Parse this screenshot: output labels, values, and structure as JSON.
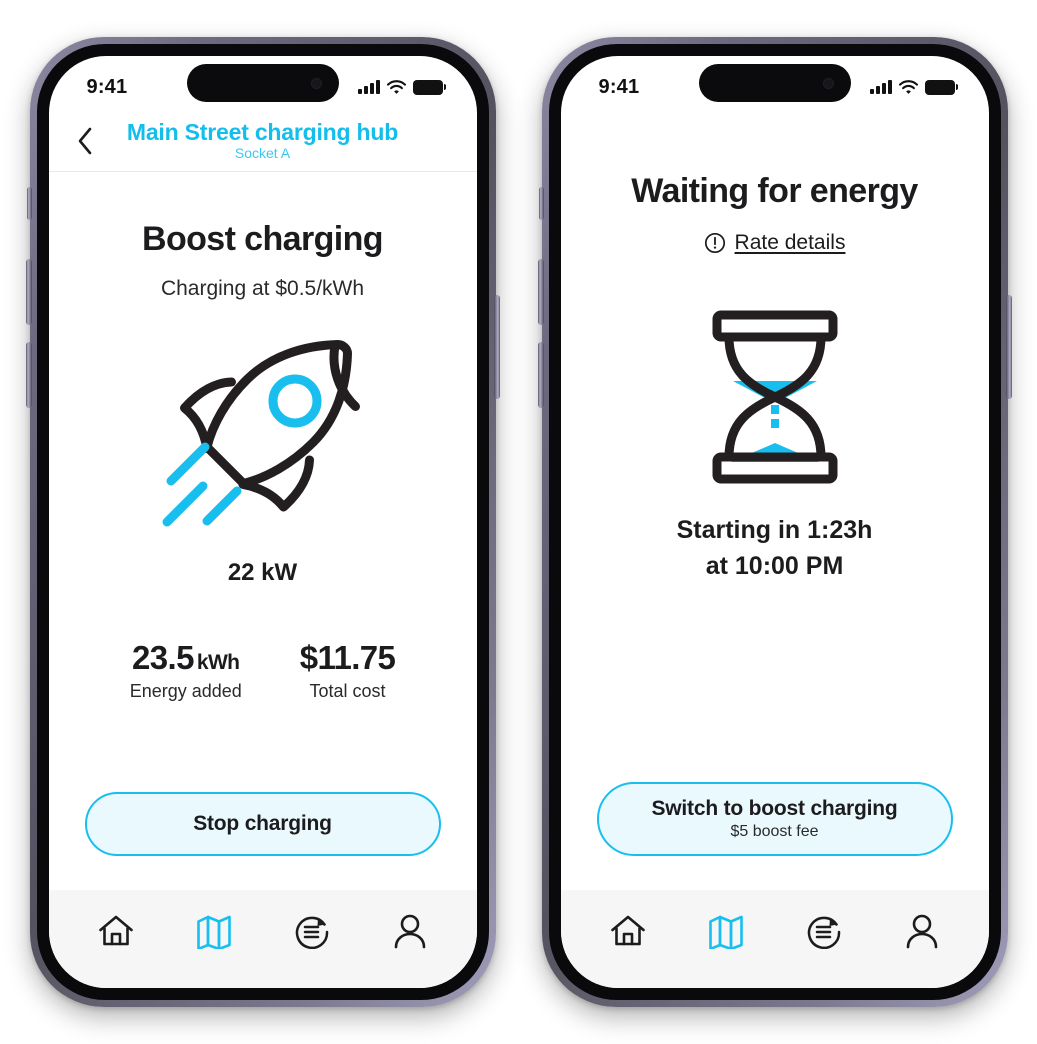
{
  "colors": {
    "accent": "#13BEEC",
    "accent_bright": "#18BFEE",
    "cta_fill": "#EAF9FE",
    "text_dark": "#1c1c1e",
    "tabbar_bg": "#F6F6F7",
    "frame_black": "#0a0a0c",
    "frame_titanium": "#6d6980"
  },
  "status_bar": {
    "time": "9:41",
    "icons": [
      "cellular-signal-icon",
      "wifi-icon",
      "battery-icon"
    ]
  },
  "phones": [
    {
      "id": "phone-boost-charging",
      "header": {
        "back_icon": "chevron-left-icon",
        "title": "Main Street charging hub",
        "subtitle": "Socket A"
      },
      "screen_title": "Boost charging",
      "screen_subtitle": "Charging at $0.5/kWh",
      "hero_icon": "rocket-icon",
      "power_readout": "22 kW",
      "stats": [
        {
          "value": "23.5",
          "unit": "kWh",
          "label": "Energy added"
        },
        {
          "value": "$11.75",
          "unit": "",
          "label": "Total cost"
        }
      ],
      "cta": {
        "label": "Stop charging",
        "sublabel": ""
      }
    },
    {
      "id": "phone-waiting-for-energy",
      "header": null,
      "screen_title": "Waiting for energy",
      "rate_details": {
        "icon": "exclamation-circle-icon",
        "label": "Rate details"
      },
      "hero_icon": "hourglass-icon",
      "eta_lines": [
        "Starting in 1:23h",
        "at 10:00 PM"
      ],
      "cta": {
        "label": "Switch to boost charging",
        "sublabel": "$5 boost fee"
      }
    }
  ],
  "tabbar": {
    "items": [
      {
        "icon": "home-icon",
        "name": "tab-home",
        "active": false
      },
      {
        "icon": "map-icon",
        "name": "tab-map",
        "active": true
      },
      {
        "icon": "history-icon",
        "name": "tab-history",
        "active": false
      },
      {
        "icon": "person-icon",
        "name": "tab-profile",
        "active": false
      }
    ]
  }
}
